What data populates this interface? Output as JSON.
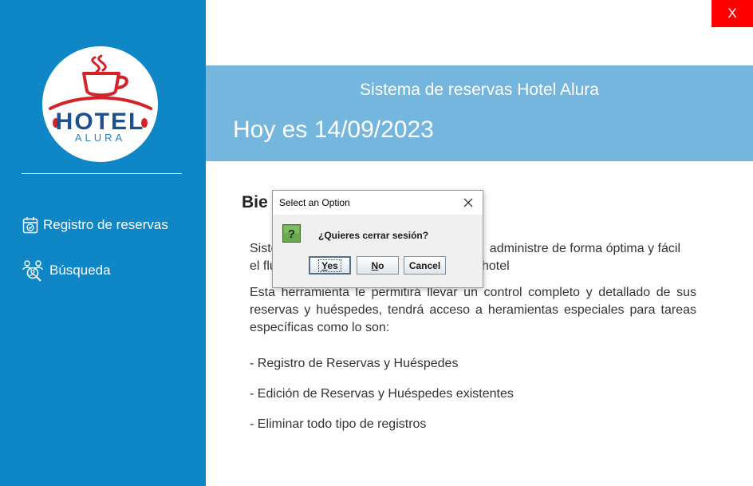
{
  "window": {
    "close_label": "X"
  },
  "sidebar": {
    "logo": {
      "text_main": "HOTEL",
      "text_sub": "ALURA"
    },
    "items": [
      {
        "label": "Registro de reservas",
        "icon": "calendar-check-icon"
      },
      {
        "label": "Búsqueda",
        "icon": "user-search-icon"
      }
    ]
  },
  "banner": {
    "title": "Sistema de reservas Hotel Alura",
    "date": "Hoy es 14/09/2023"
  },
  "content": {
    "heading": "Bie",
    "paragraph1_a": "Siste",
    "paragraph1_b": "administre de forma óptima y fácil",
    "paragraph1_c": "el flu",
    "paragraph1_d": "hotel",
    "paragraph2": "Esta herramienta le permitirá llevar un control completo y detallado de sus reservas y huéspedes, tendrá acceso a heramientas especiales para tareas específicas como lo son:",
    "bullets": [
      "- Registro de Reservas y Huéspedes",
      "- Edición de Reservas y Huéspedes existentes",
      "- Eliminar todo tipo de registros"
    ]
  },
  "dialog": {
    "title": "Select an Option",
    "message": "¿Quieres cerrar sesión?",
    "icon": "question-icon",
    "icon_glyph": "?",
    "buttons": {
      "yes_mnemonic": "Y",
      "yes_rest": "es",
      "no_mnemonic": "N",
      "no_rest": "o",
      "cancel": "Cancel"
    }
  },
  "colors": {
    "sidebar": "#0f86c6",
    "banner": "#74b6de",
    "close_button": "#ff0000",
    "logo_red": "#d52229",
    "logo_blue": "#2c7fc0"
  }
}
